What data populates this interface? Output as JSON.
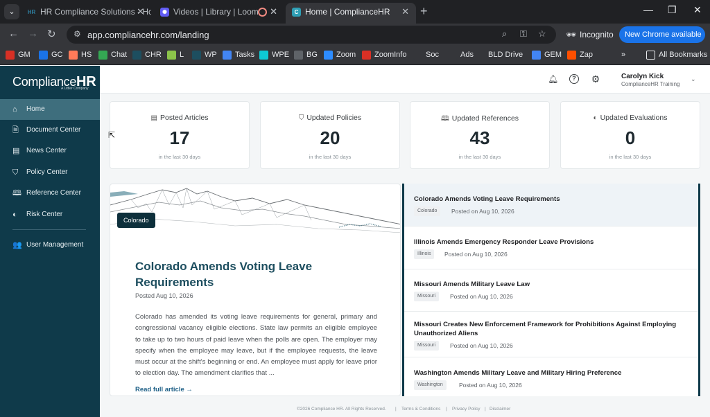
{
  "browser": {
    "tabs": [
      {
        "title": "HR Compliance Solutions - Hon",
        "favicon": "HR"
      },
      {
        "title": "Videos | Library | Loom",
        "favicon": "gear"
      },
      {
        "title": "",
        "favicon": "record"
      },
      {
        "title": "Home | ComplianceHR",
        "favicon": "C"
      }
    ],
    "url": "app.compliancehr.com/landing",
    "incognito_label": "Incognito",
    "new_chrome_label": "New Chrome available",
    "bookmarks": [
      {
        "label": "GM",
        "color": "#d93025"
      },
      {
        "label": "GC",
        "color": "#1a73e8"
      },
      {
        "label": "HS",
        "color": "#ff7a59"
      },
      {
        "label": "Chat",
        "color": "#34a853"
      },
      {
        "label": "CHR",
        "color": "#1d4e5f"
      },
      {
        "label": "L",
        "color": "#8bc34a"
      },
      {
        "label": "WP",
        "color": "#1d4e5f"
      },
      {
        "label": "Tasks",
        "color": "#4285f4"
      },
      {
        "label": "WPE",
        "color": "#0ecad4"
      },
      {
        "label": "BG",
        "color": "#5f6368"
      },
      {
        "label": "Zoom",
        "color": "#2d8cff"
      },
      {
        "label": "ZoomInfo",
        "color": "#d93025"
      },
      {
        "label": "Soc",
        "color": "#35363a"
      },
      {
        "label": "Ads",
        "color": "#35363a"
      },
      {
        "label": "BLD Drive",
        "color": "#35363a"
      },
      {
        "label": "GEM",
        "color": "#4285f4"
      },
      {
        "label": "Zap",
        "color": "#ff4f00"
      }
    ],
    "all_bookmarks_label": "All Bookmarks"
  },
  "sidebar": {
    "logo_text": "Compliance",
    "logo_bold": "HR",
    "logo_sub": "A Littler Company",
    "items": [
      {
        "label": "Home",
        "icon": "home-icon"
      },
      {
        "label": "Document Center",
        "icon": "document-icon"
      },
      {
        "label": "News Center",
        "icon": "news-icon"
      },
      {
        "label": "Policy Center",
        "icon": "shield-icon"
      },
      {
        "label": "Reference Center",
        "icon": "book-icon"
      },
      {
        "label": "Risk Center",
        "icon": "risk-shield-icon"
      },
      {
        "label": "User Management",
        "icon": "users-icon"
      }
    ]
  },
  "header": {
    "user_name": "Carolyn Kick",
    "user_org": "ComplianceHR Training"
  },
  "stats": [
    {
      "title": "Posted Articles",
      "value": "17",
      "sub": "in the last 30 days"
    },
    {
      "title": "Updated Policies",
      "value": "20",
      "sub": "in the last 30 days"
    },
    {
      "title": "Updated References",
      "value": "43",
      "sub": "in the last 30 days"
    },
    {
      "title": "Updated Evaluations",
      "value": "0",
      "sub": "in the last 30 days"
    }
  ],
  "featured": {
    "tag": "Colorado",
    "title": "Colorado Amends Voting Leave Requirements",
    "date": "Posted Aug 10, 2026",
    "body": "Colorado has amended its voting leave requirements for general, primary and congressional vacancy eligible elections. State law permits an eligible employee to take up to two hours of paid leave when the polls are open. The employer may specify when the employee may leave, but if the employee requests, the leave must occur at the shift's beginning or end. An employee must apply for leave prior to election day. The amendment clarifies that ...",
    "read_more": "Read full article →"
  },
  "news": [
    {
      "title": "Colorado Amends Voting Leave Requirements",
      "tag": "Colorado",
      "date": "Posted on Aug 10, 2026"
    },
    {
      "title": "Illinois Amends Emergency Responder Leave Provisions",
      "tag": "Illinois",
      "date": "Posted on Aug 10, 2026"
    },
    {
      "title": "Missouri Amends Military Leave Law",
      "tag": "Missouri",
      "date": "Posted on Aug 10, 2026"
    },
    {
      "title": "Missouri Creates New Enforcement Framework for Prohibitions Against Employing Unauthorized Aliens",
      "tag": "Missouri",
      "date": "Posted on Aug 10, 2026"
    },
    {
      "title": "Washington Amends Military Leave and Military Hiring Preference",
      "tag": "Washington",
      "date": "Posted on Aug 10, 2026"
    }
  ],
  "footer": {
    "copyright": "©2026 Compliance HR. All Rights Reserved.",
    "terms": "Terms & Conditions",
    "privacy": "Privacy Policy",
    "disclaimer": "Disclaimer"
  }
}
